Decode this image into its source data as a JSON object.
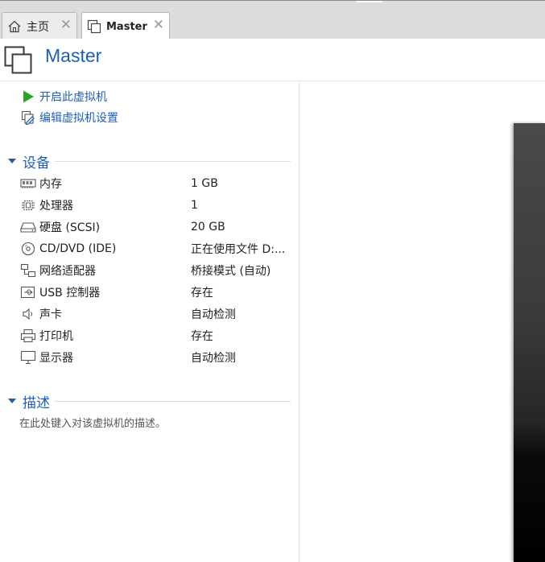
{
  "tabs": [
    {
      "label": "主页",
      "icon": "home-icon"
    },
    {
      "label": "Master",
      "icon": "vm-icon"
    }
  ],
  "tab_close_glyph": "✕",
  "vm": {
    "title": "Master"
  },
  "actions": {
    "power_on": "开启此虚拟机",
    "edit_settings": "编辑虚拟机设置"
  },
  "devices_section": {
    "title": "设备",
    "items": [
      {
        "name": "内存",
        "value": "1 GB",
        "icon": "memory-icon"
      },
      {
        "name": "处理器",
        "value": "1",
        "icon": "processor-icon"
      },
      {
        "name": "硬盘 (SCSI)",
        "value": "20 GB",
        "icon": "hard-disk-icon"
      },
      {
        "name": "CD/DVD (IDE)",
        "value": "正在使用文件 D:...",
        "icon": "cd-dvd-icon"
      },
      {
        "name": "网络适配器",
        "value": "桥接模式 (自动)",
        "icon": "network-adapter-icon"
      },
      {
        "name": "USB 控制器",
        "value": "存在",
        "icon": "usb-icon"
      },
      {
        "name": "声卡",
        "value": "自动检测",
        "icon": "speaker-icon"
      },
      {
        "name": "打印机",
        "value": "存在",
        "icon": "printer-icon"
      },
      {
        "name": "显示器",
        "value": "自动检测",
        "icon": "monitor-icon"
      }
    ]
  },
  "description_section": {
    "title": "描述",
    "placeholder": "在此处键入对该虚拟机的描述。"
  },
  "colors": {
    "accent": "#1d5fb8",
    "play_green": "#2aa52a",
    "tabbar_bg": "#dcdcdc"
  }
}
